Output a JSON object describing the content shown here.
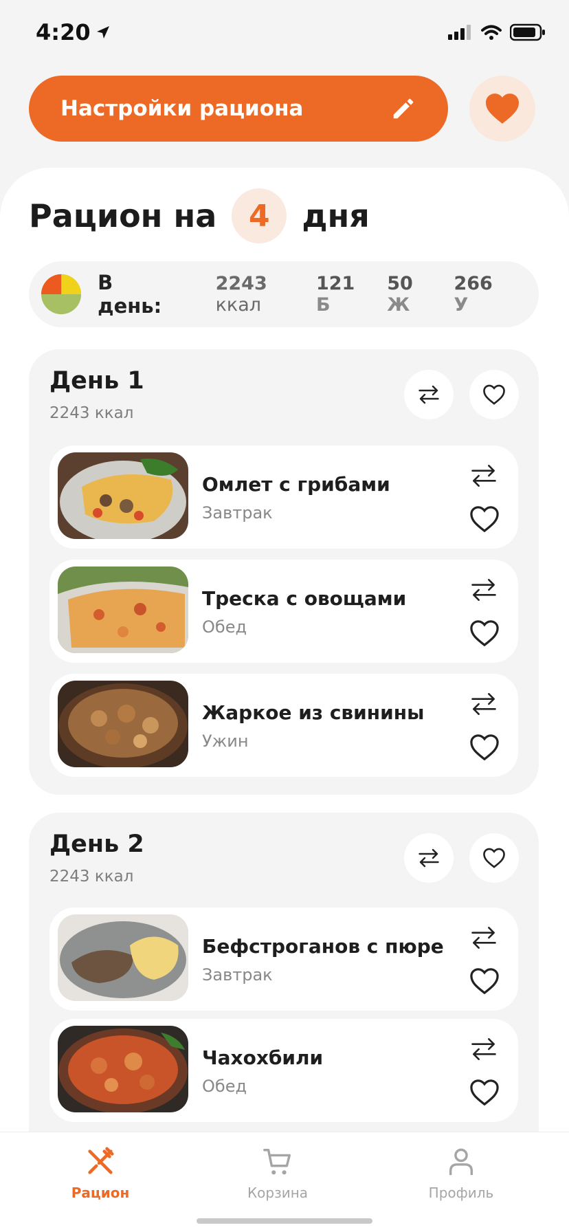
{
  "status": {
    "time": "4:20"
  },
  "header": {
    "settings_label": "Настройки рациона",
    "settings_icon": "pencil-icon",
    "favorites_icon": "heart-filled-icon"
  },
  "plan": {
    "title_prefix": "Рацион на",
    "days": "4",
    "title_suffix": "дня"
  },
  "daily": {
    "label": "В день:",
    "kcal_value": "2243",
    "kcal_unit": "ккал",
    "protein_value": "121",
    "protein_unit": "Б",
    "fat_value": "50",
    "fat_unit": "Ж",
    "carb_value": "266",
    "carb_unit": "У"
  },
  "days": [
    {
      "title": "День 1",
      "kcal": "2243 ккал",
      "meals": [
        {
          "name": "Омлет с грибами",
          "type": "Завтрак"
        },
        {
          "name": "Треска с овощами",
          "type": "Обед"
        },
        {
          "name": "Жаркое из свинины",
          "type": "Ужин"
        }
      ]
    },
    {
      "title": "День 2",
      "kcal": "2243 ккал",
      "meals": [
        {
          "name": "Бефстроганов с пюре",
          "type": "Завтрак"
        },
        {
          "name": "Чахохбили",
          "type": "Обед"
        }
      ]
    }
  ],
  "nav": {
    "plan": "Рацион",
    "cart": "Корзина",
    "profile": "Профиль"
  },
  "colors": {
    "accent": "#ec6a26",
    "accent_soft": "#fbe8dd",
    "card_bg": "#f4f4f4"
  }
}
